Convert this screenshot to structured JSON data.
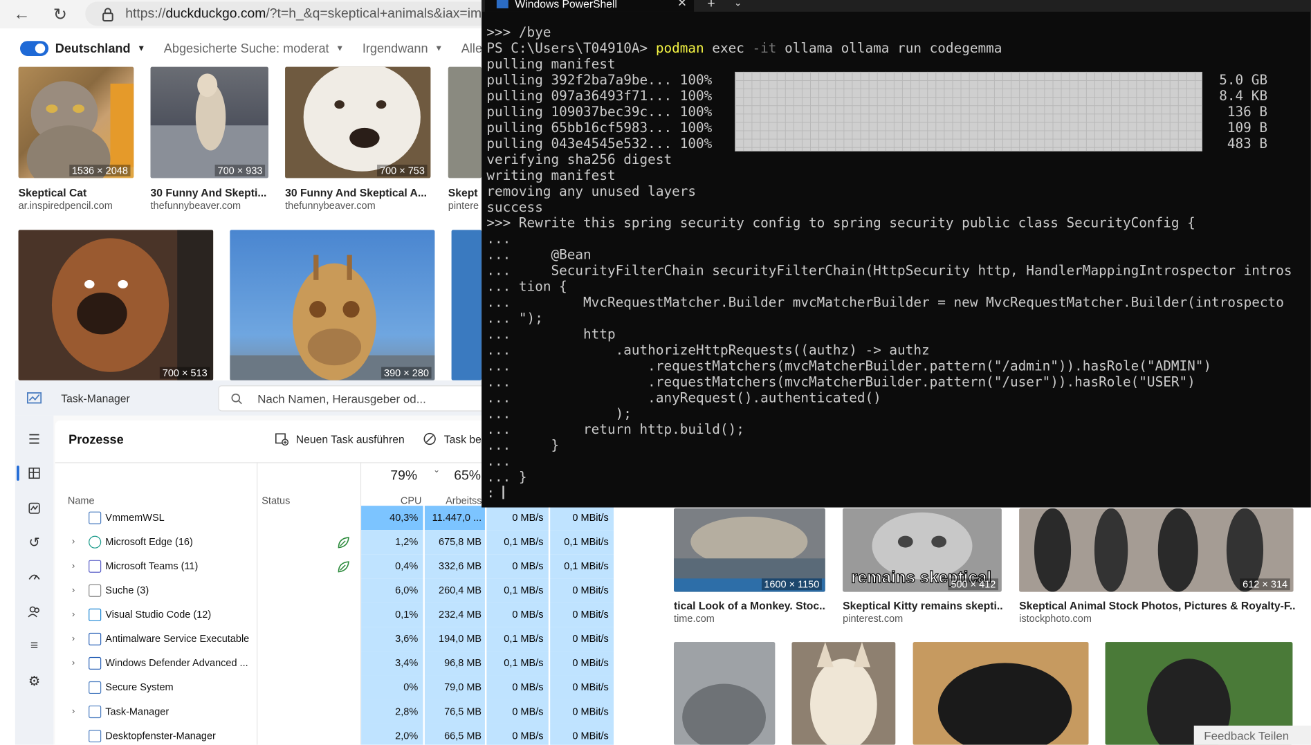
{
  "browser": {
    "url": "https://duckduckgo.com/?t=h_&q=skeptical+animals&iax=images",
    "filters": {
      "region": "Deutschland",
      "safe_search": "Abgesicherte Suche: moderat",
      "time": "Irgendwann",
      "all": "Alle"
    },
    "images": [
      {
        "dims": "1536 × 2048",
        "title": "Skeptical Cat",
        "source": "ar.inspiredpencil.com"
      },
      {
        "dims": "700 × 933",
        "title": "30 Funny And Skepti...",
        "source": "thefunnybeaver.com"
      },
      {
        "dims": "700 × 753",
        "title": "30 Funny And Skeptical A...",
        "source": "thefunnybeaver.com"
      },
      {
        "dims": "",
        "title": "Skept",
        "source": "pintere"
      },
      {
        "dims": "700 × 513",
        "title": "",
        "source": ""
      },
      {
        "dims": "390 × 280",
        "title": "",
        "source": ""
      },
      {
        "dims": "1600 × 1150",
        "title": "tical Look of a Monkey. Stoc...",
        "source": "time.com"
      },
      {
        "dims": "500 × 412",
        "title": "Skeptical Kitty remains skepti...",
        "source": "pinterest.com",
        "overlay": "remains skeptical"
      },
      {
        "dims": "612 × 314",
        "title": "Skeptical Animal Stock Photos, Pictures & Royalty-F...",
        "source": "istockphoto.com"
      }
    ],
    "feedback": "Feedback Teilen"
  },
  "taskmgr": {
    "title": "Task-Manager",
    "search_placeholder": "Nach Namen, Herausgeber od...",
    "heading": "Prozesse",
    "new_task": "Neuen Task ausführen",
    "end_task": "Task be",
    "columns": {
      "name": "Name",
      "status": "Status",
      "cpu_pct": "79%",
      "cpu": "CPU",
      "mem_pct": "65%",
      "mem": "Arbeitssp..."
    },
    "rows": [
      {
        "name": "VmmemWSL",
        "expand": false,
        "cpu": "40,3%",
        "mem": "11.447,0 ...",
        "disk": "0 MB/s",
        "net": "0 MBit/s",
        "leaf": false
      },
      {
        "name": "Microsoft Edge (16)",
        "expand": true,
        "cpu": "1,2%",
        "mem": "675,8 MB",
        "disk": "0,1 MB/s",
        "net": "0,1 MBit/s",
        "leaf": true
      },
      {
        "name": "Microsoft Teams (11)",
        "expand": true,
        "cpu": "0,4%",
        "mem": "332,6 MB",
        "disk": "0 MB/s",
        "net": "0,1 MBit/s",
        "leaf": true
      },
      {
        "name": "Suche (3)",
        "expand": true,
        "cpu": "6,0%",
        "mem": "260,4 MB",
        "disk": "0,1 MB/s",
        "net": "0 MBit/s",
        "leaf": false
      },
      {
        "name": "Visual Studio Code (12)",
        "expand": true,
        "cpu": "0,1%",
        "mem": "232,4 MB",
        "disk": "0 MB/s",
        "net": "0 MBit/s",
        "leaf": false
      },
      {
        "name": "Antimalware Service Executable",
        "expand": true,
        "cpu": "3,6%",
        "mem": "194,0 MB",
        "disk": "0,1 MB/s",
        "net": "0 MBit/s",
        "leaf": false
      },
      {
        "name": "Windows Defender Advanced ...",
        "expand": true,
        "cpu": "3,4%",
        "mem": "96,8 MB",
        "disk": "0,1 MB/s",
        "net": "0 MBit/s",
        "leaf": false
      },
      {
        "name": "Secure System",
        "expand": false,
        "cpu": "0%",
        "mem": "79,0 MB",
        "disk": "0 MB/s",
        "net": "0 MBit/s",
        "leaf": false
      },
      {
        "name": "Task-Manager",
        "expand": true,
        "cpu": "2,8%",
        "mem": "76,5 MB",
        "disk": "0 MB/s",
        "net": "0 MBit/s",
        "leaf": false
      },
      {
        "name": "Desktopfenster-Manager",
        "expand": false,
        "cpu": "2,0%",
        "mem": "66,5 MB",
        "disk": "0 MB/s",
        "net": "0 MBit/s",
        "leaf": false
      }
    ]
  },
  "powershell": {
    "tab_title": "Windows PowerShell",
    "lines": [
      ">>> /bye",
      "PS C:\\Users\\T04910A> |podman exec -it ollama ollama run codegemma",
      "pulling manifest",
      "pulling 392f2ba7a9be... 100%",
      "pulling 097a36493f71... 100%",
      "pulling 109037bec39c... 100%",
      "pulling 65bb16cf5983... 100%",
      "pulling 043e4545e532... 100%",
      "verifying sha256 digest",
      "writing manifest",
      "removing any unused layers",
      "success",
      ">>> Rewrite this spring security config to spring security public class SecurityConfig {",
      "...",
      "...     @Bean",
      "...     SecurityFilterChain securityFilterChain(HttpSecurity http, HandlerMappingIntrospector intros",
      "... tion {",
      "...         MvcRequestMatcher.Builder mvcMatcherBuilder = new MvcRequestMatcher.Builder(introspecto",
      "... \");",
      "...         http",
      "...             .authorizeHttpRequests((authz) -> authz",
      "...                 .requestMatchers(mvcMatcherBuilder.pattern(\"/admin\")).hasRole(\"ADMIN\")",
      "...                 .requestMatchers(mvcMatcherBuilder.pattern(\"/user\")).hasRole(\"USER\")",
      "...                 .anyRequest().authenticated()",
      "...             );",
      "...         return http.build();",
      "...     }",
      "...",
      "... }",
      ":"
    ],
    "sizes": [
      "5.0 GB",
      "8.4 KB",
      "136 B",
      "109 B",
      "483 B"
    ]
  }
}
